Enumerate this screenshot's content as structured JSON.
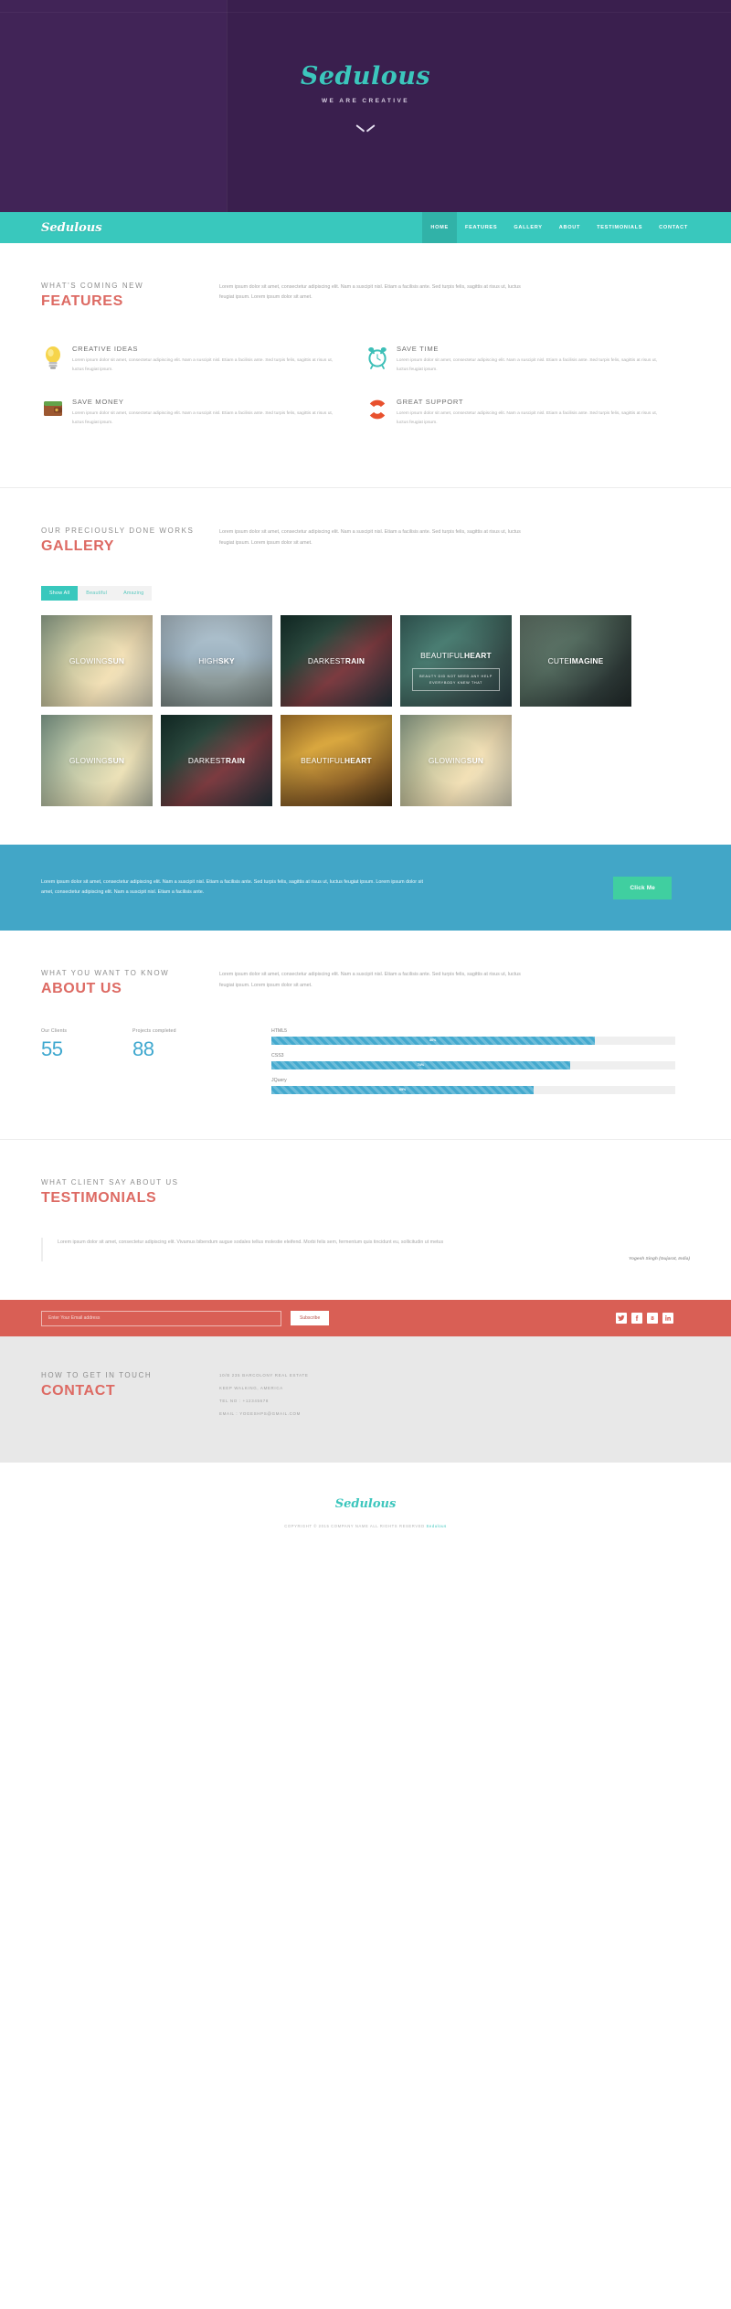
{
  "hero": {
    "logo": "Sedulous",
    "tagline": "WE ARE CREATIVE",
    "scroll_icon": "chevron-down-icon"
  },
  "nav": {
    "logo": "Sedulous",
    "items": [
      {
        "label": "HOME",
        "active": true
      },
      {
        "label": "FEATURES",
        "active": false
      },
      {
        "label": "GALLERY",
        "active": false
      },
      {
        "label": "ABOUT",
        "active": false
      },
      {
        "label": "TESTIMONIALS",
        "active": false
      },
      {
        "label": "CONTACT",
        "active": false
      }
    ]
  },
  "features": {
    "subtitle": "WHAT'S COMING NEW",
    "title": "FEATURES",
    "description": "Lorem ipsum dolor sit amet, consectetur adipiscing elit. Nam a suscipit nisl. Etiam a facilisis ante. Sed turpis felis, sagittis at risus ut, luctus feugiat ipsum. Lorem ipsum dolor sit amet.",
    "items": [
      {
        "icon": "lightbulb-icon",
        "title": "CREATIVE IDEAS",
        "text": "Lorem ipsum dolor sit amet, consectetur adipiscing elit. Nam a suscipit nisl. Etiam a facilisis ante. Sed turpis felis, sagittis at risus ut, luctus feugiat ipsum."
      },
      {
        "icon": "alarm-clock-icon",
        "title": "SAVE TIME",
        "text": "Lorem ipsum dolor sit amet, consectetur adipiscing elit. Nam a suscipit nisl. Etiam a facilisis ante. Sed turpis felis, sagittis at risus ut, luctus feugiat ipsum."
      },
      {
        "icon": "wallet-icon",
        "title": "SAVE MONEY",
        "text": "Lorem ipsum dolor sit amet, consectetur adipiscing elit. Nam a suscipit nisl. Etiam a facilisis ante. Sed turpis felis, sagittis at risus ut, luctus feugiat ipsum."
      },
      {
        "icon": "lifebuoy-icon",
        "title": "GREAT SUPPORT",
        "text": "Lorem ipsum dolor sit amet, consectetur adipiscing elit. Nam a suscipit nisl. Etiam a facilisis ante. Sed turpis felis, sagittis at risus ut, luctus feugiat ipsum."
      }
    ]
  },
  "gallery": {
    "subtitle": "OUR PRECIOUSLY DONE WORKS",
    "title": "GALLERY",
    "description": "Lorem ipsum dolor sit amet, consectetur adipiscing elit. Nam a suscipit nisl. Etiam a facilisis ante. Sed turpis felis, sagittis at risus ut, luctus feugiat ipsum. Lorem ipsum dolor sit amet.",
    "filters": [
      {
        "label": "Show All",
        "active": true
      },
      {
        "label": "Beautiful",
        "active": false
      },
      {
        "label": "Amazing",
        "active": false
      }
    ],
    "items": [
      {
        "word1": "GLOWING",
        "word2": "SUN",
        "theme": "ph-sun",
        "hover": null
      },
      {
        "word1": "HIGH",
        "word2": "SKY",
        "theme": "ph-sky",
        "hover": null
      },
      {
        "word1": "DARKEST",
        "word2": "RAIN",
        "theme": "ph-rain",
        "hover": null
      },
      {
        "word1": "BEAUTIFUL",
        "word2": "HEART",
        "theme": "ph-heart1",
        "hover": "BEAUTY DID NOT NEED ANY HELP EVERYBODY KNEW THAT"
      },
      {
        "word1": "CUTE",
        "word2": "IMAGINE",
        "theme": "ph-imag",
        "hover": null
      },
      {
        "word1": "GLOWING",
        "word2": "SUN",
        "theme": "ph-sun2",
        "hover": null
      },
      {
        "word1": "DARKEST",
        "word2": "RAIN",
        "theme": "ph-rain",
        "hover": null
      },
      {
        "word1": "BEAUTIFUL",
        "word2": "HEART",
        "theme": "ph-heart2",
        "hover": null
      },
      {
        "word1": "GLOWING",
        "word2": "SUN",
        "theme": "ph-sun",
        "hover": null
      }
    ]
  },
  "cta": {
    "text": "Lorem ipsum dolor sit amet, consectetur adipiscing elit. Nam a suscipit nisl. Etiam a facilisis ante. Sed turpis felis, sagittis at risus ut, luctus feugiat ipsum. Lorem ipsum dolor sit amet, consectetur adipiscing elit. Nam a suscipit nisl. Etiam a facilisis ante.",
    "button": "Click Me"
  },
  "about": {
    "subtitle": "WHAT YOU WANT TO KNOW",
    "title": "ABOUT US",
    "description": "Lorem ipsum dolor sit amet, consectetur adipiscing elit. Nam a suscipit nisl. Etiam a facilisis ante. Sed turpis felis, sagittis at risus ut, luctus feugiat ipsum. Lorem ipsum dolor sit amet.",
    "counters": [
      {
        "label": "Our Clients",
        "value": "55"
      },
      {
        "label": "Projects completed",
        "value": "88"
      }
    ],
    "skills": [
      {
        "name": "HTML5",
        "percent": 80,
        "percent_label": "80%"
      },
      {
        "name": "CSS3",
        "percent": 74,
        "percent_label": "74%"
      },
      {
        "name": "JQuery",
        "percent": 65,
        "percent_label": "65%"
      }
    ]
  },
  "testimonials": {
    "subtitle": "WHAT CLIENT SAY ABOUT US",
    "title": "TESTIMONIALS",
    "quote": "Lorem ipsum dolor sit amet, consectetur adipiscing elit. Vivamus bibendum augue sodales tellus molestie eleifend. Morbi felis sem, fermentum quis tincidunt eu, sollicitudin ut metus",
    "author": "Yogesh Singh (Gujarat, India)"
  },
  "subscribe": {
    "placeholder": "Enter Your Email address",
    "value": "",
    "button": "Subscribe",
    "socials": [
      {
        "name": "twitter-icon"
      },
      {
        "name": "facebook-icon"
      },
      {
        "name": "google-plus-icon"
      },
      {
        "name": "linkedin-icon"
      }
    ]
  },
  "contact": {
    "subtitle": "HOW TO GET IN TOUCH",
    "title": "CONTACT",
    "lines": [
      "10/B 235 BARCOLONY REAL ESTATE",
      "KEEP WALKING, AMERICA",
      "TEL NO : +12345678",
      "EMAIL : YOGESHPS@GMAIL.COM"
    ]
  },
  "footer": {
    "logo": "Sedulous",
    "copyright_prefix": "COPYRIGHT © 2015 COMPANY NAME ALL RIGHTS RESERVED ",
    "copyright_link": "Sedulous"
  },
  "colors": {
    "teal": "#39c8bd",
    "purple": "#3b2050",
    "red": "#dd6a63",
    "blue": "#42a6c7",
    "green": "#40cfa0",
    "subscribe_red": "#d95f55"
  }
}
